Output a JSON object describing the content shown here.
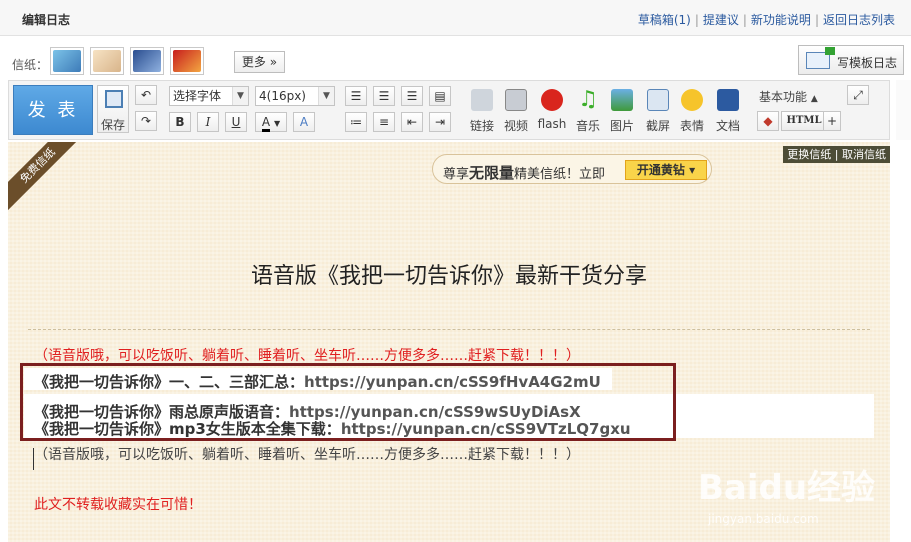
{
  "header": {
    "title": "编辑日志",
    "links": [
      "草稿箱(1)",
      "提建议",
      "新功能说明",
      "返回日志列表"
    ]
  },
  "paper": {
    "label": "信纸：",
    "more": "更多",
    "template_btn": "写模板日志"
  },
  "toolbar": {
    "publish": "发 表",
    "save": "保存",
    "font_select": "选择字体",
    "size_select": "4(16px)",
    "tools": [
      "链接",
      "视频",
      "flash",
      "音乐",
      "图片",
      "截屏",
      "表情",
      "文档"
    ],
    "basic": "基本功能",
    "html": "HTML"
  },
  "editor": {
    "ribbon": "免费信纸",
    "change_links": [
      "更换信纸",
      "取消信纸"
    ],
    "promo_pre": "尊享",
    "promo_bold": "无限量",
    "promo_post": "精美信纸！立即",
    "promo_btn": "开通黄钻",
    "article_title": "语音版《我把一切告诉你》最新干货分享",
    "red_line": "（语音版哦，可以吃饭听、躺着听、睡着听、坐车听……方便多多……赶紧下载！！！）",
    "line1_label": "《我把一切告诉你》一、二、三部汇总：",
    "line1_url": "https://yunpan.cn/cSS9fHvA4G2mU",
    "line2_label": "《我把一切告诉你》雨总原声版语音：",
    "line2_url": "https://yunpan.cn/cSS9wSUyDiAsX",
    "line3_label": "《我把一切告诉你》mp3女生版本全集下载：",
    "line3_url": "https://yunpan.cn/cSS9VTzLQ7gxu",
    "gray_line": "（语音版哦，可以吃饭听、躺着听、睡着听、坐车听……方便多多……赶紧下载！！！）",
    "bottom_red": "此文不转载收藏实在可惜！",
    "watermark": "Baidu经验",
    "watermark_sub": "jingyan.baidu.com"
  }
}
